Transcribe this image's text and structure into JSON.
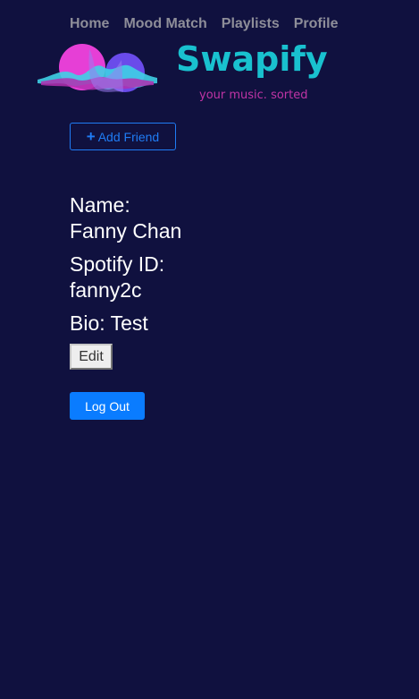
{
  "nav": {
    "items": [
      {
        "label": "Home"
      },
      {
        "label": "Mood Match"
      },
      {
        "label": "Playlists"
      },
      {
        "label": "Profile"
      }
    ]
  },
  "logo": {
    "wordmark": "Swapify",
    "tagline": "your music. sorted"
  },
  "add_friend": {
    "icon": "plus-icon",
    "label": "Add Friend"
  },
  "profile": {
    "name_label": "Name:",
    "name_value": "Fanny Chan",
    "spotify_label": "Spotify ID:",
    "spotify_value": "fanny2c",
    "bio_label": "Bio:",
    "bio_value": "Test"
  },
  "edit_label": "Edit",
  "logout_label": "Log Out",
  "colors": {
    "background": "#10113f",
    "nav_text": "#8e8e99",
    "brand_teal": "#19c1cf",
    "brand_magenta": "#c034a5",
    "primary_blue": "#0a7cff"
  }
}
